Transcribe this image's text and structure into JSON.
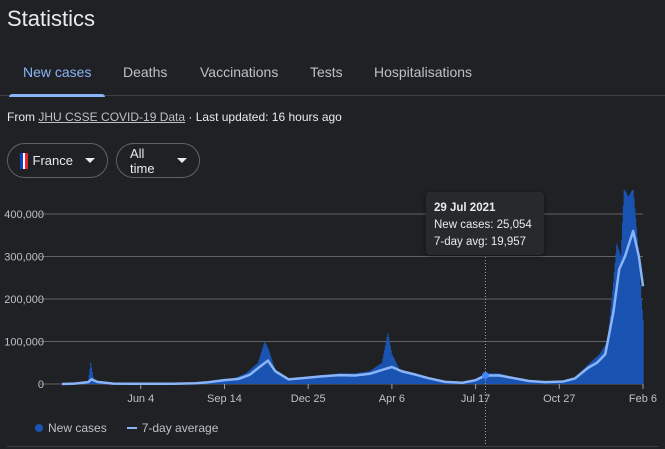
{
  "title": "Statistics",
  "tabs": [
    {
      "label": "New cases"
    },
    {
      "label": "Deaths"
    },
    {
      "label": "Vaccinations"
    },
    {
      "label": "Tests"
    },
    {
      "label": "Hospitalisations"
    }
  ],
  "source": {
    "prefix": "From",
    "link": "JHU CSSE COVID-19 Data",
    "suffix": "· Last updated: 16 hours ago"
  },
  "filters": {
    "country": "France",
    "range": "All time"
  },
  "colors": {
    "bars": "#1a54b3",
    "avg": "#8ab4f8",
    "accent": "#8ab4f8"
  },
  "tooltip": {
    "date": "29 Jul 2021",
    "new_cases": "New cases: 25,054",
    "avg": "7-day avg: 19,957"
  },
  "legend": {
    "new_cases": "New cases",
    "avg": "7-day average"
  },
  "chart_data": {
    "type": "bar",
    "start": "2020-02-29",
    "end": "2022-02-06",
    "ylim": [
      0,
      400000
    ],
    "yticks": [
      {
        "v": 0,
        "label": "0"
      },
      {
        "v": 100000,
        "label": "100,000"
      },
      {
        "v": 200000,
        "label": "200,000"
      },
      {
        "v": 300000,
        "label": "300,000"
      },
      {
        "v": 400000,
        "label": "400,000"
      }
    ],
    "xticks": [
      {
        "date": "2020-06-04",
        "label": "Jun 4"
      },
      {
        "date": "2020-09-14",
        "label": "Sep 14"
      },
      {
        "date": "2020-12-25",
        "label": "Dec 25"
      },
      {
        "date": "2021-04-06",
        "label": "Apr 6"
      },
      {
        "date": "2021-07-17",
        "label": "Jul 17"
      },
      {
        "date": "2021-10-27",
        "label": "Oct 27"
      },
      {
        "date": "2022-02-06",
        "label": "Feb 6"
      }
    ],
    "highlight": {
      "date": "2021-07-29",
      "new_cases": 25054,
      "avg": 19957
    },
    "series": [
      {
        "name": "New cases",
        "points": [
          [
            "2020-02-29",
            0
          ],
          [
            "2020-03-15",
            1000
          ],
          [
            "2020-04-01",
            7000
          ],
          [
            "2020-04-04",
            50000
          ],
          [
            "2020-04-08",
            6000
          ],
          [
            "2020-04-20",
            3000
          ],
          [
            "2020-05-10",
            1000
          ],
          [
            "2020-06-15",
            500
          ],
          [
            "2020-07-15",
            800
          ],
          [
            "2020-08-10",
            2000
          ],
          [
            "2020-08-25",
            5000
          ],
          [
            "2020-09-10",
            9000
          ],
          [
            "2020-09-25",
            13000
          ],
          [
            "2020-10-10",
            25000
          ],
          [
            "2020-10-25",
            50000
          ],
          [
            "2020-11-02",
            100000
          ],
          [
            "2020-11-07",
            80000
          ],
          [
            "2020-11-15",
            30000
          ],
          [
            "2020-12-01",
            12000
          ],
          [
            "2020-12-20",
            15000
          ],
          [
            "2021-01-10",
            20000
          ],
          [
            "2021-02-01",
            25000
          ],
          [
            "2021-02-20",
            25000
          ],
          [
            "2021-03-10",
            30000
          ],
          [
            "2021-03-25",
            50000
          ],
          [
            "2021-04-01",
            120000
          ],
          [
            "2021-04-06",
            70000
          ],
          [
            "2021-04-15",
            35000
          ],
          [
            "2021-05-01",
            25000
          ],
          [
            "2021-05-20",
            12000
          ],
          [
            "2021-06-10",
            4000
          ],
          [
            "2021-07-01",
            3000
          ],
          [
            "2021-07-17",
            12000
          ],
          [
            "2021-07-29",
            25054
          ],
          [
            "2021-08-15",
            25000
          ],
          [
            "2021-09-01",
            15000
          ],
          [
            "2021-09-20",
            8000
          ],
          [
            "2021-10-10",
            5000
          ],
          [
            "2021-11-01",
            7000
          ],
          [
            "2021-11-15",
            15000
          ],
          [
            "2021-12-01",
            45000
          ],
          [
            "2021-12-15",
            70000
          ],
          [
            "2021-12-25",
            100000
          ],
          [
            "2022-01-01",
            240000
          ],
          [
            "2022-01-05",
            330000
          ],
          [
            "2022-01-10",
            300000
          ],
          [
            "2022-01-14",
            460000
          ],
          [
            "2022-01-19",
            440000
          ],
          [
            "2022-01-25",
            460000
          ],
          [
            "2022-02-01",
            300000
          ],
          [
            "2022-02-04",
            200000
          ],
          [
            "2022-02-06",
            150000
          ]
        ]
      },
      {
        "name": "7-day average",
        "points": [
          [
            "2020-02-29",
            0
          ],
          [
            "2020-03-15",
            1000
          ],
          [
            "2020-04-01",
            4500
          ],
          [
            "2020-04-05",
            11000
          ],
          [
            "2020-04-12",
            5000
          ],
          [
            "2020-05-01",
            1000
          ],
          [
            "2020-06-01",
            500
          ],
          [
            "2020-07-15",
            600
          ],
          [
            "2020-08-10",
            1800
          ],
          [
            "2020-08-25",
            4000
          ],
          [
            "2020-09-14",
            9000
          ],
          [
            "2020-10-01",
            12000
          ],
          [
            "2020-10-15",
            22000
          ],
          [
            "2020-10-28",
            42000
          ],
          [
            "2020-11-06",
            55000
          ],
          [
            "2020-11-15",
            30000
          ],
          [
            "2020-12-01",
            11000
          ],
          [
            "2020-12-20",
            14000
          ],
          [
            "2021-01-10",
            18000
          ],
          [
            "2021-02-01",
            21000
          ],
          [
            "2021-02-20",
            20000
          ],
          [
            "2021-03-10",
            24000
          ],
          [
            "2021-03-25",
            33000
          ],
          [
            "2021-04-06",
            40000
          ],
          [
            "2021-04-18",
            30000
          ],
          [
            "2021-05-05",
            22000
          ],
          [
            "2021-05-20",
            14000
          ],
          [
            "2021-06-10",
            5000
          ],
          [
            "2021-07-01",
            3000
          ],
          [
            "2021-07-17",
            9000
          ],
          [
            "2021-07-29",
            19957
          ],
          [
            "2021-08-15",
            20000
          ],
          [
            "2021-09-01",
            14000
          ],
          [
            "2021-09-20",
            7000
          ],
          [
            "2021-10-10",
            4500
          ],
          [
            "2021-11-01",
            6000
          ],
          [
            "2021-11-15",
            13000
          ],
          [
            "2021-12-01",
            38000
          ],
          [
            "2021-12-12",
            50000
          ],
          [
            "2021-12-22",
            70000
          ],
          [
            "2022-01-01",
            170000
          ],
          [
            "2022-01-08",
            270000
          ],
          [
            "2022-01-15",
            300000
          ],
          [
            "2022-01-25",
            360000
          ],
          [
            "2022-02-01",
            300000
          ],
          [
            "2022-02-06",
            230000
          ]
        ]
      }
    ]
  }
}
